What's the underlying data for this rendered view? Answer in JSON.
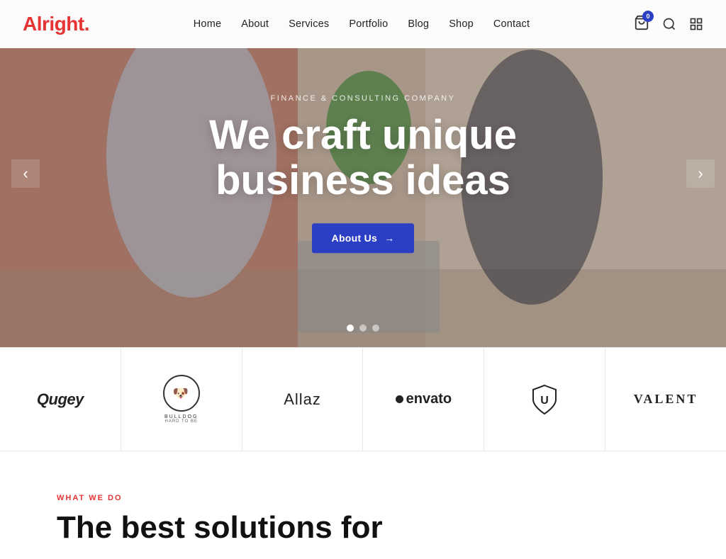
{
  "brand": {
    "name": "Alright",
    "dot": ".",
    "dot_color": "#e63333"
  },
  "nav": {
    "items": [
      {
        "label": "Home",
        "href": "#"
      },
      {
        "label": "About",
        "href": "#"
      },
      {
        "label": "Services",
        "href": "#"
      },
      {
        "label": "Portfolio",
        "href": "#"
      },
      {
        "label": "Blog",
        "href": "#"
      },
      {
        "label": "Shop",
        "href": "#"
      },
      {
        "label": "Contact",
        "href": "#"
      }
    ]
  },
  "cart": {
    "badge": "0"
  },
  "hero": {
    "subtitle": "Finance & Consulting Company",
    "title_line1": "We craft unique",
    "title_line2": "business ideas",
    "cta_label": "About Us",
    "cta_arrow": "→",
    "dots": [
      {
        "active": true
      },
      {
        "active": false
      },
      {
        "active": false
      }
    ],
    "prev_label": "‹",
    "next_label": "›"
  },
  "logos": [
    {
      "id": "qugey",
      "text": "Qugey",
      "style": "italic"
    },
    {
      "id": "bulldog",
      "text": "BULLDOG",
      "subtitle": "HARD TO BE"
    },
    {
      "id": "allaz",
      "text": "Allaz",
      "style": "normal"
    },
    {
      "id": "envato",
      "text": "envato",
      "prefix_dot": true
    },
    {
      "id": "shield",
      "text": "U-shield"
    },
    {
      "id": "valent",
      "text": "VALENT",
      "style": "wide"
    }
  ],
  "what_we_do": {
    "label": "WHAT WE DO",
    "title": "The best solutions for"
  }
}
